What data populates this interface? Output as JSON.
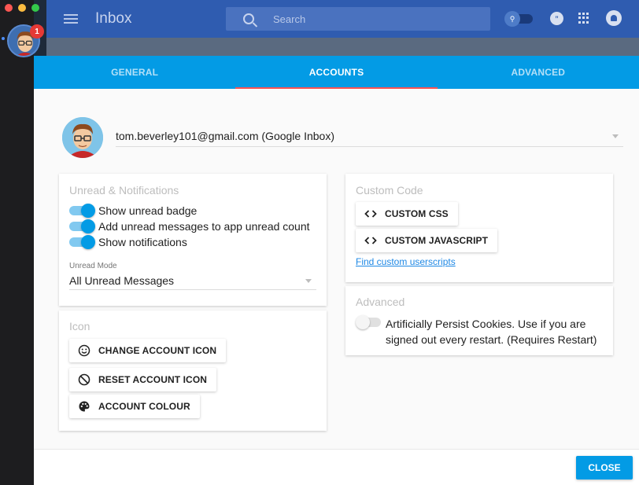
{
  "app": {
    "title": "Inbox",
    "search_placeholder": "Search",
    "unread_badge": "1"
  },
  "tabs": [
    {
      "label": "GENERAL",
      "active": false
    },
    {
      "label": "ACCOUNTS",
      "active": true
    },
    {
      "label": "ADVANCED",
      "active": false
    }
  ],
  "account": {
    "email": "tom.beverley101@gmail.com (Google Inbox)"
  },
  "unread": {
    "title": "Unread & Notifications",
    "toggles": [
      {
        "label": "Show unread badge",
        "on": true
      },
      {
        "label": "Add unread messages to app unread count",
        "on": true
      },
      {
        "label": "Show notifications",
        "on": true
      }
    ],
    "mode_label": "Unread Mode",
    "mode_value": "All Unread Messages"
  },
  "icon": {
    "title": "Icon",
    "change_label": "CHANGE ACCOUNT ICON",
    "reset_label": "RESET ACCOUNT ICON",
    "colour_label": "ACCOUNT COLOUR"
  },
  "custom_code": {
    "title": "Custom Code",
    "css_label": "CUSTOM CSS",
    "js_label": "CUSTOM JAVASCRIPT",
    "link_label": "Find custom userscripts"
  },
  "advanced": {
    "title": "Advanced",
    "persist_label": "Artificially Persist Cookies. Use if you are signed out every restart. (Requires Restart)",
    "persist_on": false
  },
  "footer": {
    "close_label": "CLOSE"
  },
  "colors": {
    "accent": "#039be5",
    "tab_indicator": "#ff5252",
    "appbar": "#2f5cb0"
  }
}
